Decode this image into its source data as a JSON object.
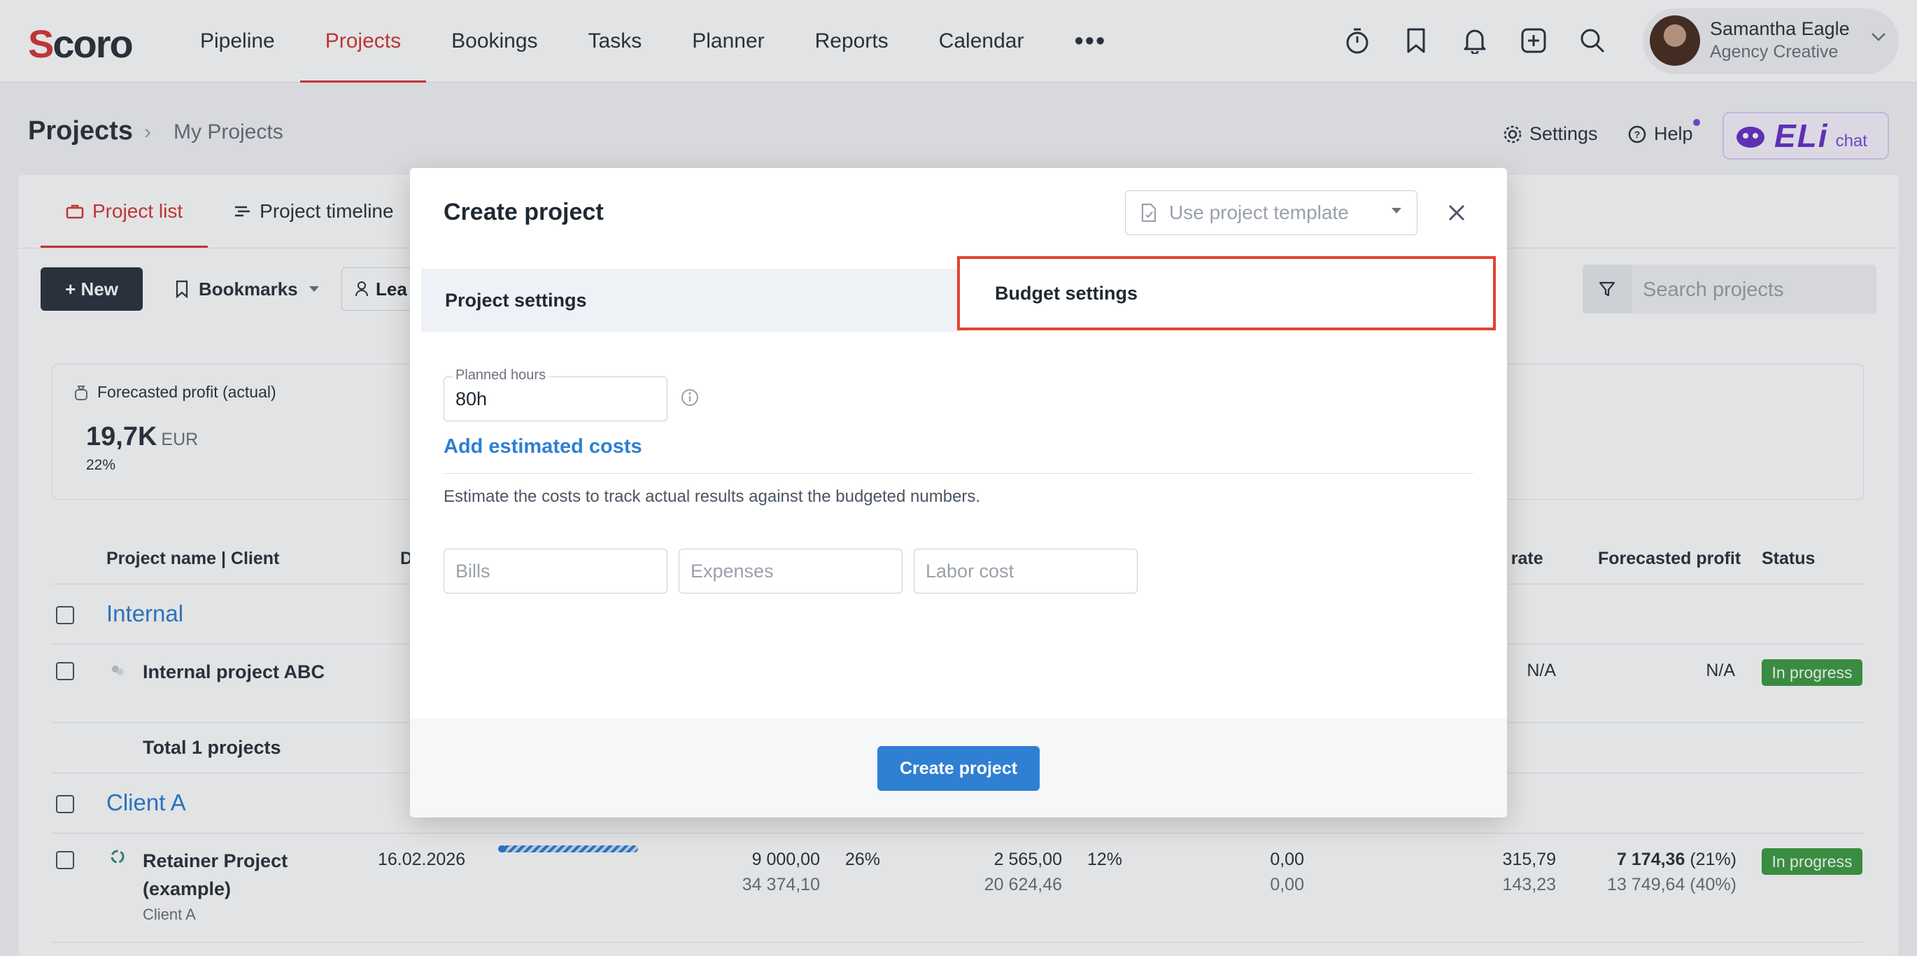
{
  "app": {
    "logo": "Scoro"
  },
  "nav": {
    "items": [
      {
        "label": "Pipeline"
      },
      {
        "label": "Projects"
      },
      {
        "label": "Bookings"
      },
      {
        "label": "Tasks"
      },
      {
        "label": "Planner"
      },
      {
        "label": "Reports"
      },
      {
        "label": "Calendar"
      }
    ],
    "more": "•••"
  },
  "user": {
    "name": "Samantha Eagle",
    "role": "Agency Creative"
  },
  "header": {
    "title": "Projects",
    "separator": "›",
    "subtitle": "My Projects",
    "settings": "Settings",
    "help": "Help",
    "eli_logo": "ELi",
    "eli_chat": "chat"
  },
  "tabs": {
    "project_list": "Project list",
    "project_timeline": "Project timeline"
  },
  "toolbar": {
    "new": "+ New",
    "bookmarks": "Bookmarks",
    "lead": "Lea",
    "search_placeholder": "Search projects"
  },
  "kpi": {
    "label": "Forecasted profit (actual)",
    "value": "19,7K",
    "unit": "EUR",
    "pct": "22%"
  },
  "table": {
    "headers": {
      "name": "Project name | Client",
      "d": "D",
      "rate": "le rate",
      "profit": "Forecasted profit",
      "status": "Status"
    },
    "groups": [
      {
        "name": "Internal",
        "project": {
          "name": "Internal project ABC",
          "rate": "N/A",
          "profit": "N/A",
          "status": "In progress"
        },
        "total": "Total 1 projects"
      },
      {
        "name": "Client A",
        "project": {
          "name_line1": "Retainer Project",
          "name_line2": "(example)",
          "client": "Client A",
          "date": "16.02.2026",
          "progress": 0.06,
          "v1_top": "9 000,00",
          "v1_bottom": "34 374,10",
          "p1": "26%",
          "v2_top": "2 565,00",
          "v2_bottom": "20 624,46",
          "p2": "12%",
          "v3_top": "0,00",
          "v3_bottom": "0,00",
          "rate_top": "315,79",
          "rate_bottom": "143,23",
          "profit_top": "7 174,36",
          "profit_top_pct": "(21%)",
          "profit_bottom": "13 749,64 (40%)",
          "status": "In progress"
        }
      }
    ]
  },
  "modal": {
    "title": "Create project",
    "template_placeholder": "Use project template",
    "tab_project": "Project settings",
    "tab_budget": "Budget settings",
    "planned_hours_label": "Planned hours",
    "planned_hours_value": "80h",
    "add_costs": "Add estimated costs",
    "hint": "Estimate the costs to track actual results against the budgeted numbers.",
    "bills_placeholder": "Bills",
    "expenses_placeholder": "Expenses",
    "labor_placeholder": "Labor cost",
    "create_button": "Create project"
  },
  "colors": {
    "brand_red": "#d63a3a",
    "accent_blue": "#2f7fd3",
    "status_green": "#3f9c45",
    "highlight": "#e2432f",
    "eli_purple": "#6a34c9"
  }
}
